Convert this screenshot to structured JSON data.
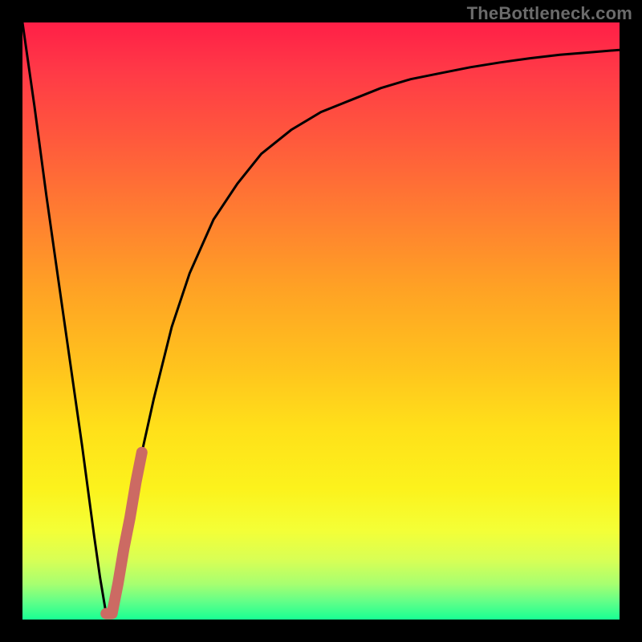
{
  "watermark": "TheBottleneck.com",
  "colors": {
    "frame": "#000000",
    "curve": "#000000",
    "highlight": "#cc6a63",
    "gradient_top": "#ff1f47",
    "gradient_bottom": "#18ff93"
  },
  "chart_data": {
    "type": "line",
    "title": "",
    "xlabel": "",
    "ylabel": "",
    "xlim": [
      0,
      100
    ],
    "ylim": [
      0,
      100
    ],
    "grid": false,
    "legend": false,
    "series": [
      {
        "name": "main-curve",
        "x": [
          0,
          2,
          4,
          6,
          8,
          10,
          12,
          13,
          14,
          15,
          16,
          18,
          20,
          22,
          25,
          28,
          32,
          36,
          40,
          45,
          50,
          55,
          60,
          65,
          70,
          75,
          80,
          85,
          90,
          95,
          100
        ],
        "y": [
          100,
          86,
          71,
          57,
          43,
          29,
          14,
          7,
          1,
          1,
          6,
          17,
          28,
          37,
          49,
          58,
          67,
          73,
          78,
          82,
          85,
          87,
          89,
          90.5,
          91.5,
          92.5,
          93.3,
          94,
          94.6,
          95,
          95.4
        ]
      },
      {
        "name": "highlight-segment",
        "x": [
          14,
          15,
          16,
          17,
          18,
          19,
          20
        ],
        "y": [
          1,
          1,
          6,
          12,
          17,
          23,
          28
        ]
      }
    ],
    "annotations": []
  }
}
